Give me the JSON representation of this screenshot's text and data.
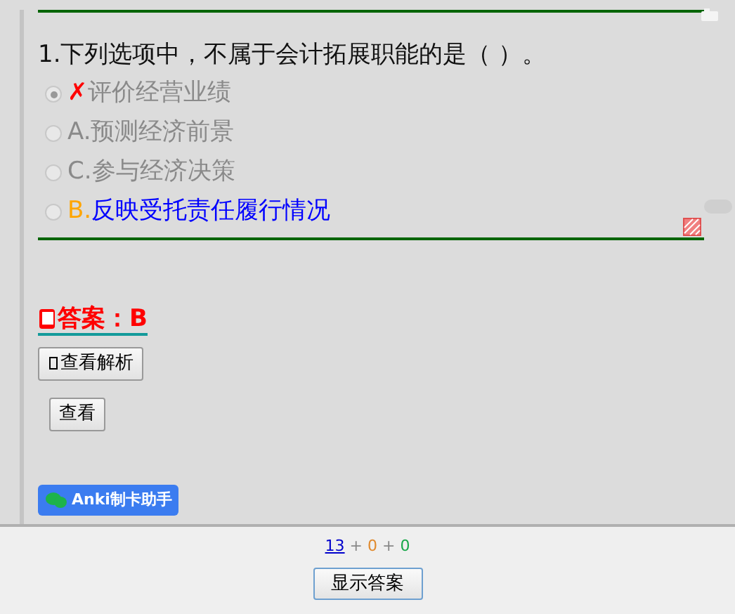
{
  "question": "1.下列选项中，不属于会计拓展职能的是（ ）。",
  "options": [
    {
      "mark": "✗",
      "text": "评价经营业绩",
      "selected": true,
      "correct": false
    },
    {
      "letter": "A.",
      "text": "预测经济前景",
      "selected": false,
      "correct": false
    },
    {
      "letter": "C.",
      "text": "参与经济决策",
      "selected": false,
      "correct": false
    },
    {
      "letter": "B.",
      "text": "反映受托责任履行情况",
      "selected": false,
      "correct": true
    }
  ],
  "answer": "答案：B",
  "buttons": [
    "查看解析",
    "查看"
  ],
  "badge": "Anki制卡助手",
  "counts": [
    {
      "text": "13",
      "color": "#0000cc",
      "underlined": true
    },
    {
      "text": "0",
      "color": "#e08a2e",
      "underlined": false
    },
    {
      "text": "0",
      "color": "#18a84a",
      "underlined": false
    }
  ],
  "separator": "+",
  "show_answer": "显示答案"
}
